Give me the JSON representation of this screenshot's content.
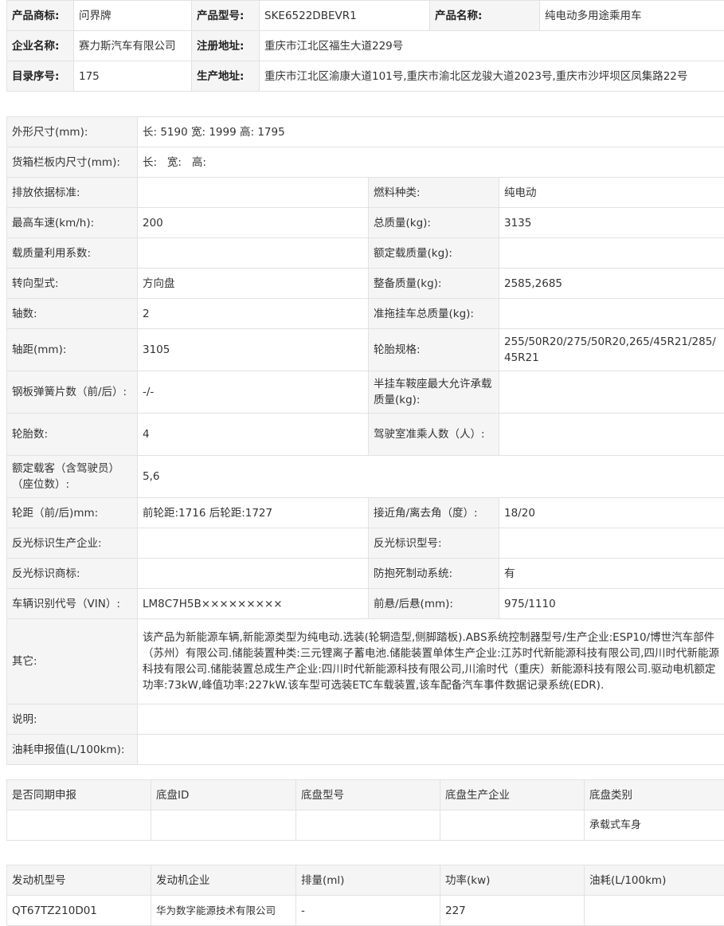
{
  "header": {
    "brand_label": "产品商标:",
    "brand": "问界牌",
    "model_label": "产品型号:",
    "model": "SKE6522DBEVR1",
    "name_label": "产品名称:",
    "name": "纯电动多用途乘用车",
    "company_label": "企业名称:",
    "company": "赛力斯汽车有限公司",
    "reg_addr_label": "注册地址:",
    "reg_addr": "重庆市江北区福生大道229号",
    "catalog_label": "目录序号:",
    "catalog": "175",
    "prod_addr_label": "生产地址:",
    "prod_addr": "重庆市江北区渝康大道101号,重庆市渝北区龙骏大道2023号,重庆市沙坪坝区凤集路22号"
  },
  "specs": {
    "dims_label": "外形尺寸(mm):",
    "dims": "长: 5190 宽: 1999 高: 1795",
    "cargo_label": "货箱栏板内尺寸(mm):",
    "cargo": "长:   宽:   高:",
    "emission_label": "排放依据标准:",
    "emission": "",
    "fuel_label": "燃料种类:",
    "fuel": "纯电动",
    "speed_label": "最高车速(km/h):",
    "speed": "200",
    "gross_label": "总质量(kg):",
    "gross": "3135",
    "util_label": "载质量利用系数:",
    "util": "",
    "rated_load_label": "额定载质量(kg):",
    "rated_load": "",
    "steer_label": "转向型式:",
    "steer": "方向盘",
    "curb_label": "整备质量(kg):",
    "curb": "2585,2685",
    "axles_label": "轴数:",
    "axles": "2",
    "trailer_label": "准拖挂车总质量(kg):",
    "trailer": "",
    "wheelbase_label": "轴距(mm):",
    "wheelbase": "3105",
    "tire_spec_label": "轮胎规格:",
    "tire_spec": "255/50R20/275/50R20,265/45R21/285/45R21",
    "spring_label": "钢板弹簧片数（前/后）:",
    "spring": "-/-",
    "saddle_label": "半挂车鞍座最大允许承载质量(kg):",
    "saddle": "",
    "tires_label": "轮胎数:",
    "tires": "4",
    "cab_label": "驾驶室准乘人数（人）:",
    "cab": "",
    "seats_label": "额定载客（含驾驶员）（座位数）:",
    "seats": "5,6",
    "track_label": "轮距（前/后)mm:",
    "track": "前轮距:1716 后轮距:1727",
    "angle_label": "接近角/离去角（度）:",
    "angle": "18/20",
    "reflect_mfr_label": "反光标识生产企业:",
    "reflect_mfr": "",
    "reflect_model_label": "反光标识型号:",
    "reflect_model": "",
    "reflect_brand_label": "反光标识商标:",
    "reflect_brand": "",
    "abs_label": "防抱死制动系统:",
    "abs": "有",
    "vin_label": "车辆识别代号（VIN）:",
    "vin": "LM8C7H5B×××××××××",
    "overhang_label": "前悬/后悬(mm):",
    "overhang": "975/1110",
    "other_label": "其它:",
    "other": "该产品为新能源车辆,新能源类型为纯电动.选装(轮辋造型,侧脚踏板).ABS系统控制器型号/生产企业:ESP10/博世汽车部件（苏州）有限公司.储能装置种类:三元锂离子蓄电池.储能装置单体生产企业:江苏时代新能源科技有限公司,四川时代新能源科技有限公司.储能装置总成生产企业:四川时代新能源科技有限公司,川渝时代（重庆）新能源科技有限公司.驱动电机额定功率:73kW,峰值功率:227kW.该车型可选装ETC车载装置,该车配备汽车事件数据记录系统(EDR).",
    "note_label": "说明:",
    "note": "",
    "consumption_label": "油耗申报值(L/100km):",
    "consumption": ""
  },
  "chassis": {
    "headers": [
      "是否同期申报",
      "底盘ID",
      "底盘型号",
      "底盘生产企业",
      "底盘类别"
    ],
    "row": [
      "",
      "",
      "",
      "",
      "承载式车身"
    ]
  },
  "engine": {
    "headers": [
      "发动机型号",
      "发动机企业",
      "排量(ml)",
      "功率(kw)",
      "油耗(L/100km)"
    ],
    "row": [
      "QT67TZ210D01",
      "华为数字能源技术有限公司",
      "-",
      "227",
      ""
    ]
  }
}
